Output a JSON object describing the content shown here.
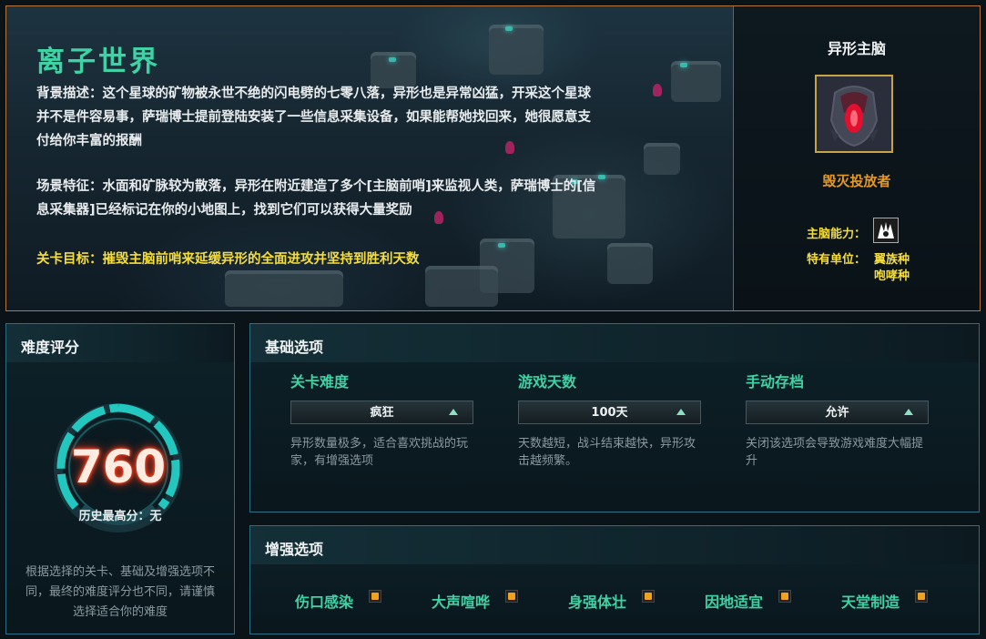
{
  "stage": {
    "title": "离子世界",
    "background": "背景描述：这个星球的矿物被永世不绝的闪电劈的七零八落，异形也是异常凶猛，开采这个星球并不是件容易事，萨瑞博士提前登陆安装了一些信息采集设备，如果能帮她找回来，她很愿意支付给你丰富的报酬",
    "features": "场景特征：水面和矿脉较为散落，异形在附近建造了多个[主脑前哨]来监视人类，萨瑞博士的[信息采集器]已经标记在你的小地图上，找到它们可以获得大量奖励",
    "objective": "关卡目标：摧毁主脑前哨来延缓异形的全面进攻并坚持到胜利天数"
  },
  "boss": {
    "title": "异形主脑",
    "name": "毁灭投放者",
    "ability_label": "主脑能力：",
    "ability_icon": "alien-claw-icon",
    "units_label": "特有单位：",
    "units": [
      "翼族种",
      "咆哮种"
    ]
  },
  "difficulty": {
    "title": "难度评分",
    "score": "760",
    "highscore": "历史最高分：无",
    "note": "根据选择的关卡、基础及增强选项不同，最终的难度评分也不同，请谨慎选择适合你的难度"
  },
  "basic": {
    "title": "基础选项",
    "options": [
      {
        "label": "关卡难度",
        "value": "疯狂",
        "desc": "异形数量极多，适合喜欢挑战的玩家，有增强选项"
      },
      {
        "label": "游戏天数",
        "value": "100天",
        "desc": "天数越短，战斗结束越快，异形攻击越频繁。"
      },
      {
        "label": "手动存档",
        "value": "允许",
        "desc": "关闭该选项会导致游戏难度大幅提升"
      }
    ]
  },
  "enhanced": {
    "title": "增强选项",
    "options": [
      {
        "label": "伤口感染",
        "checked": true
      },
      {
        "label": "大声喧哗",
        "checked": true
      },
      {
        "label": "身强体壮",
        "checked": true
      },
      {
        "label": "因地适宜",
        "checked": true
      },
      {
        "label": "天堂制造",
        "checked": true
      }
    ]
  },
  "colors": {
    "accent_green": "#3fd2a4",
    "objective_yellow": "#f5dd3a",
    "boss_orange": "#e39a25",
    "score_glow": "#e3341a",
    "panel_border": "#2c6e84"
  }
}
